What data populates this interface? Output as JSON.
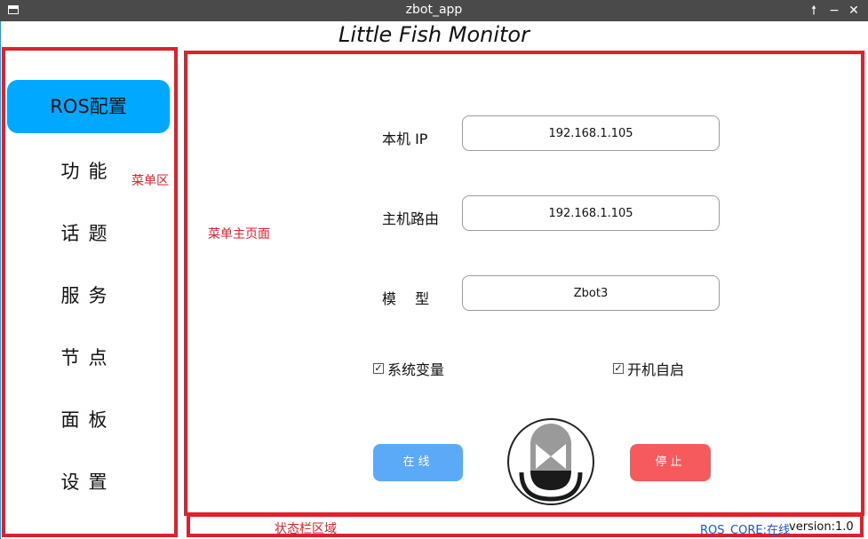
{
  "window": {
    "title": "zbot_app"
  },
  "heading": "Little Fish Monitor",
  "annotations": {
    "menu_area": "菜单区",
    "main_page": "菜单主页面",
    "status_area": "状态栏区域"
  },
  "sidebar": {
    "items": [
      {
        "label": "ROS配置",
        "active": true
      },
      {
        "label": "功能"
      },
      {
        "label": "话题"
      },
      {
        "label": "服务"
      },
      {
        "label": "节点"
      },
      {
        "label": "面板"
      },
      {
        "label": "设置"
      }
    ]
  },
  "form": {
    "local_ip": {
      "label": "本机 IP",
      "value": "192.168.1.105"
    },
    "host_route": {
      "label": "主机路由",
      "value": "192.168.1.105"
    },
    "model": {
      "label": "模 型",
      "value": "Zbot3"
    },
    "sys_var": {
      "label": "系统变量",
      "checked": true
    },
    "autostart": {
      "label": "开机自启",
      "checked": true
    }
  },
  "buttons": {
    "online": "在线",
    "stop": "停止"
  },
  "status": {
    "ros_core": "ROS_CORE:在线",
    "version": "version:1.0"
  },
  "colors": {
    "accent_blue": "#00a8ff",
    "online_blue": "#5aaaf8",
    "stop_red": "#f75a5d",
    "annotation_red": "#e0202a",
    "status_blue": "#1a55d8"
  },
  "icons": {
    "app": "window-icon",
    "maximize": "arrow-up-icon",
    "minimize": "minus-icon",
    "close": "close-icon",
    "play": "play-icon"
  }
}
